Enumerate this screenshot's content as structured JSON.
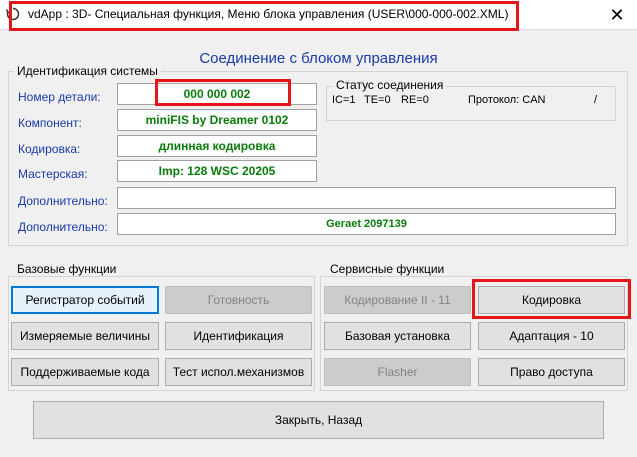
{
  "window": {
    "title": "vdApp : 3D- Специальная функция,  Меню блока управления (USER\\000-000-002.XML)",
    "close_symbol": "✕",
    "app_icon": "refresh-icon"
  },
  "heading": "Соединение с блоком управления",
  "identification": {
    "group_label": "Идентификация системы",
    "fields": [
      {
        "label": "Номер детали:",
        "value": "000 000 002"
      },
      {
        "label": "Компонент:",
        "value": "miniFIS by Dreamer  0102"
      },
      {
        "label": "Кодировка:",
        "value": "длинная кодировка"
      },
      {
        "label": "Мастерская:",
        "value": "Imp: 128     WSC 20205"
      },
      {
        "label": "Дополнительно:",
        "value": ""
      },
      {
        "label": "Дополнительно:",
        "value": "Geraet 2097139"
      }
    ]
  },
  "connection_status": {
    "group_label": "Статус соединения",
    "ic": "IC=1",
    "te": "TE=0",
    "re": "RE=0",
    "protocol": "Протокол: CAN",
    "extra": "/"
  },
  "basic_functions": {
    "group_label": "Базовые функции",
    "buttons": [
      {
        "label": "Регистратор событий"
      },
      {
        "label": "Готовность"
      },
      {
        "label": "Измеряемые величины"
      },
      {
        "label": "Идентификация"
      },
      {
        "label": "Поддерживаемые кода"
      },
      {
        "label": "Тест испол.механизмов"
      }
    ]
  },
  "service_functions": {
    "group_label": "Сервисные функции",
    "buttons": [
      {
        "label": "Кодирование II - 11"
      },
      {
        "label": "Кодировка"
      },
      {
        "label": "Базовая установка"
      },
      {
        "label": "Адаптация - 10"
      },
      {
        "label": "Flasher"
      },
      {
        "label": "Право доступа"
      }
    ]
  },
  "footer": {
    "close_label": "Закрыть, Назад"
  },
  "colors": {
    "highlight_red": "#e8141c",
    "field_text_green": "#087b0a",
    "label_blue": "#1a3aa8"
  }
}
